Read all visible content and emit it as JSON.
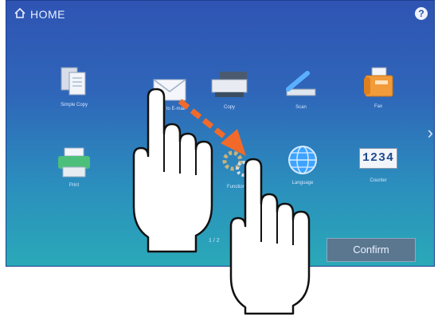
{
  "header": {
    "title": "HOME",
    "help": "?"
  },
  "apps": [
    {
      "label": "Simple Copy",
      "icon": "copy-icon"
    },
    {
      "label": "Scan to E-mail",
      "icon": "email-icon"
    },
    {
      "label": "Copy",
      "icon": "copier-icon"
    },
    {
      "label": "Scan",
      "icon": "scan-icon"
    },
    {
      "label": "Fax",
      "icon": "fax-icon"
    },
    {
      "label": "Print",
      "icon": "printer-icon"
    },
    {
      "label": "",
      "icon": "template-icon"
    },
    {
      "label": "Functions",
      "icon": "settings-icon"
    },
    {
      "label": "Language",
      "icon": "globe-icon"
    },
    {
      "label": "Counter",
      "icon": "counter-icon"
    }
  ],
  "counter_digits": "1234",
  "pager": {
    "text": "1 / 2"
  },
  "confirm_label": "Confirm",
  "colors": {
    "accent_arrow": "#f26a2a",
    "screen_top": "#2f54b3",
    "screen_bottom": "#2aa9b8"
  }
}
